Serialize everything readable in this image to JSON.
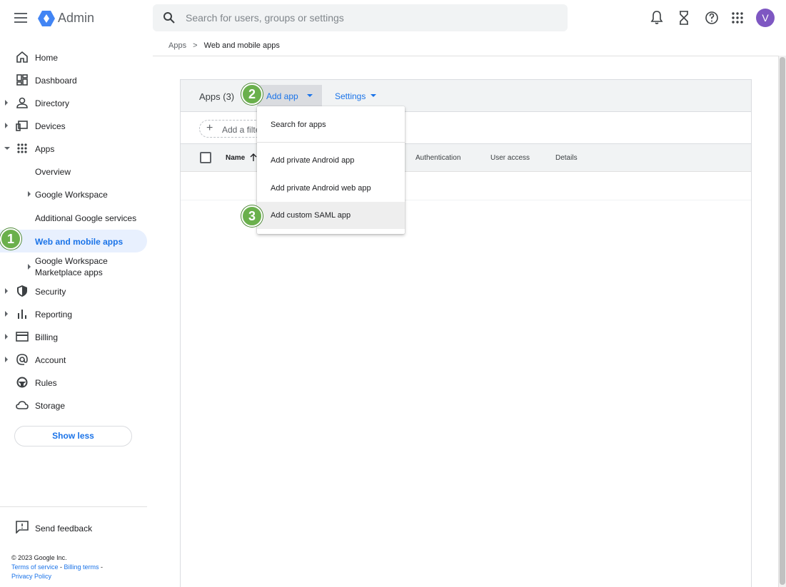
{
  "header": {
    "brand": "Admin",
    "search_placeholder": "Search for users, groups or settings",
    "avatar_letter": "V"
  },
  "sidebar": {
    "items": [
      {
        "label": "Home"
      },
      {
        "label": "Dashboard"
      },
      {
        "label": "Directory"
      },
      {
        "label": "Devices"
      },
      {
        "label": "Apps"
      },
      {
        "label": "Overview"
      },
      {
        "label": "Google Workspace"
      },
      {
        "label": "Additional Google services"
      },
      {
        "label": "Web and mobile apps"
      },
      {
        "label_line1": "Google Workspace",
        "label_line2": "Marketplace apps"
      },
      {
        "label": "Security"
      },
      {
        "label": "Reporting"
      },
      {
        "label": "Billing"
      },
      {
        "label": "Account"
      },
      {
        "label": "Rules"
      },
      {
        "label": "Storage"
      }
    ],
    "show_less": "Show less",
    "send_feedback": "Send feedback",
    "copyright": "© 2023 Google Inc.",
    "terms": "Terms of service",
    "billing_terms": "Billing terms",
    "privacy": "Privacy Policy"
  },
  "breadcrumb": {
    "parent": "Apps",
    "separator": ">",
    "current": "Web and mobile apps"
  },
  "main": {
    "apps_title": "Apps (3)",
    "add_app": "Add app",
    "settings": "Settings",
    "add_filter": "Add a filter",
    "columns": [
      "Name",
      "Authentication",
      "User access",
      "Details"
    ]
  },
  "menu": {
    "items": [
      "Search for apps",
      "Add private Android app",
      "Add private Android web app",
      "Add custom SAML app"
    ]
  },
  "badges": [
    "1",
    "2",
    "3"
  ],
  "colors": {
    "accent": "#1a73e8",
    "badge": "#6ab04c",
    "avatar": "#7e57c2"
  }
}
